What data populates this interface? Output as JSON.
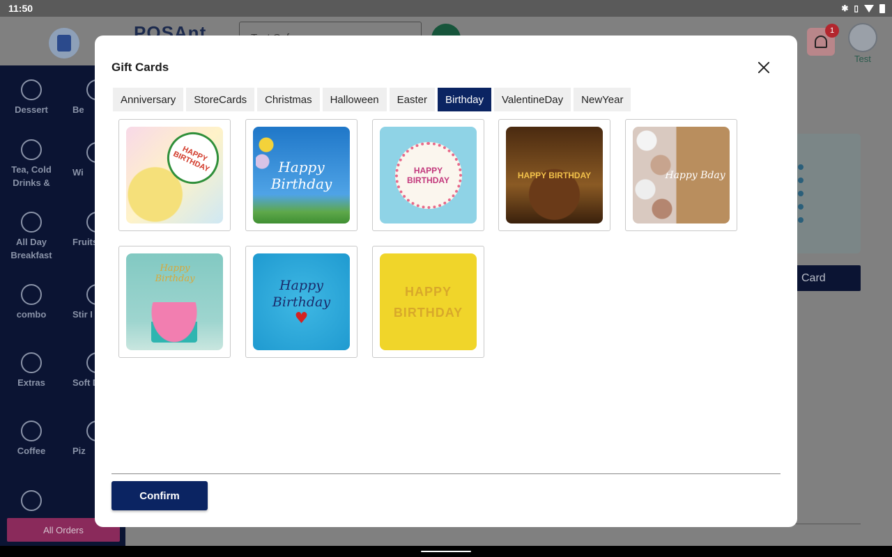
{
  "status_bar": {
    "time": "11:50"
  },
  "background": {
    "brand": "POSAnt",
    "store_name": "Test Cafe",
    "notification_count": "1",
    "user_name": "Test",
    "categories_left": [
      "Dessert",
      "Tea, Cold Drinks &",
      "All Day Breakfast",
      "combo",
      "Extras",
      "Coffee"
    ],
    "categories_right": [
      "Be",
      "Wi",
      "Fruits Veg",
      "Stir I",
      "Soft D",
      "Piz"
    ],
    "all_orders": "All Orders",
    "card_button": "Card"
  },
  "modal": {
    "title": "Gift Cards",
    "tabs": [
      "Anniversary",
      "StoreCards",
      "Christmas",
      "Halloween",
      "Easter",
      "Birthday",
      "ValentineDay",
      "NewYear"
    ],
    "active_tab": "Birthday",
    "cards": [
      {
        "text": "HAPPY BIRTHDAY"
      },
      {
        "text": "Happy Birthday"
      },
      {
        "text": "HAPPY BIRTHDAY"
      },
      {
        "text": "HAPPY BIRTHDAY"
      },
      {
        "text": "Happy Bday"
      },
      {
        "text": "Happy Birthday"
      },
      {
        "text": "Happy Birthday"
      },
      {
        "text": "HAPPY BIRTHDAY"
      }
    ],
    "confirm_label": "Confirm"
  },
  "colors": {
    "primary": "#0b2462",
    "sidebar": "#0b1433",
    "accent_orders": "#8a2a5b"
  }
}
